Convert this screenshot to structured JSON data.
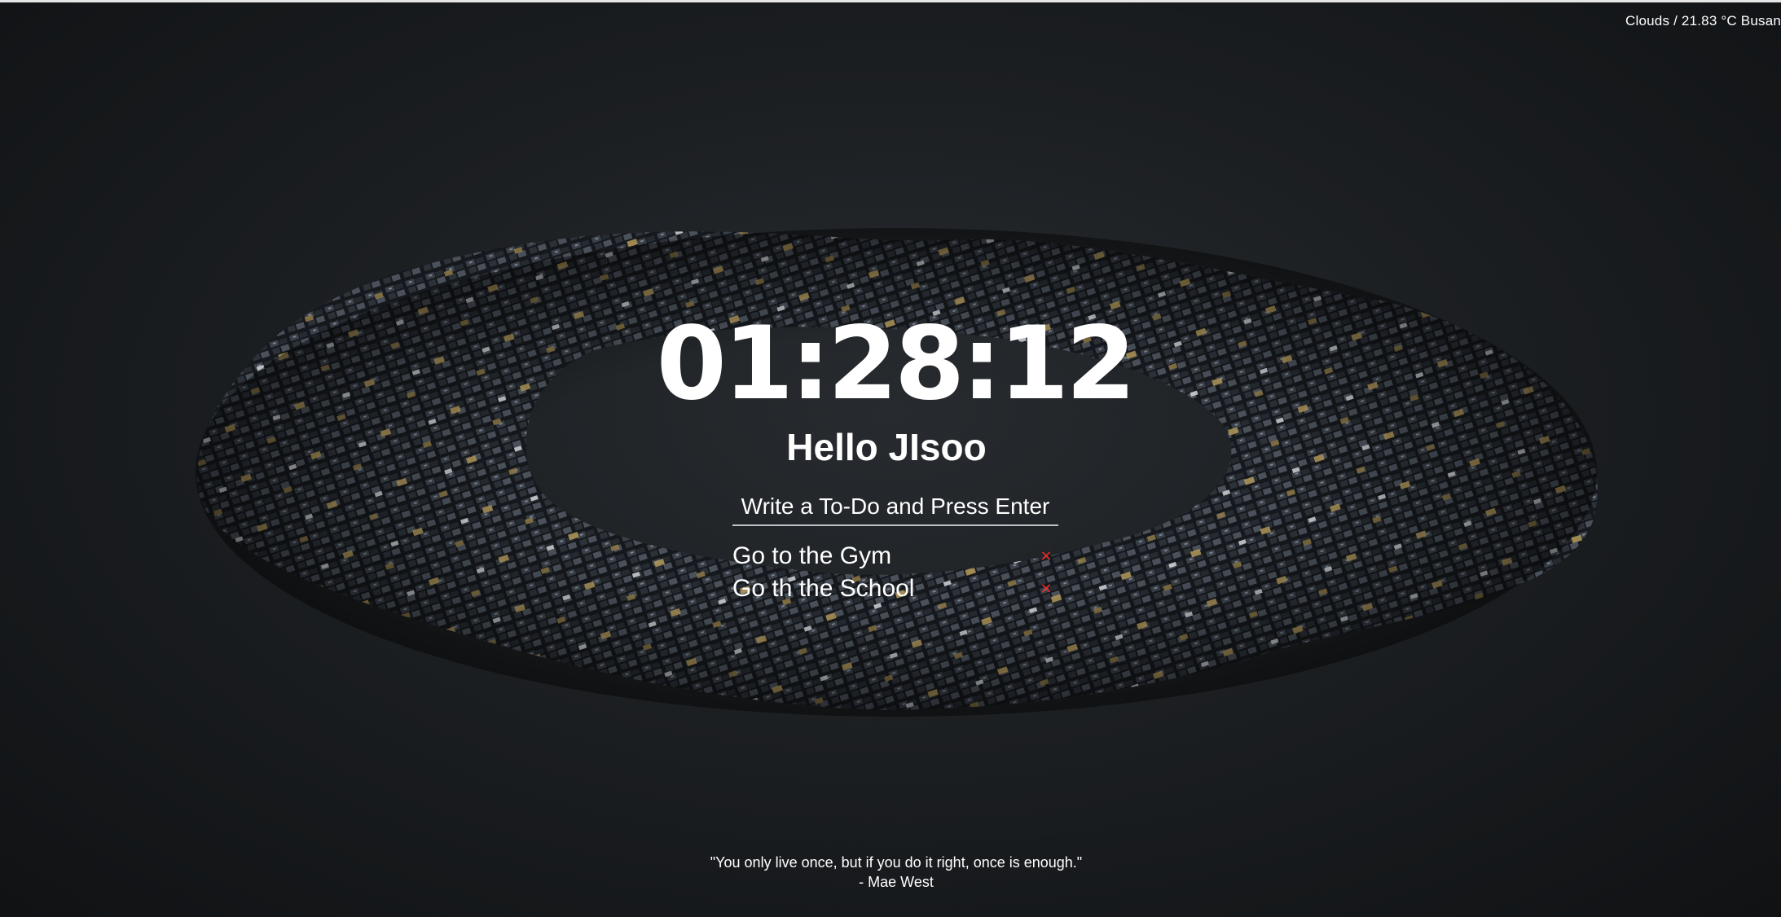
{
  "weather": {
    "text": "Clouds / 21.83 °C Busan"
  },
  "clock": {
    "time": "01:28:12"
  },
  "greeting": {
    "text": "Hello JIsoo"
  },
  "todo": {
    "placeholder": "Write a To-Do and Press Enter",
    "input_value": "",
    "items": [
      {
        "label": "Go to the Gym",
        "delete_label": "×"
      },
      {
        "label": "Go th the School",
        "delete_label": "×"
      }
    ]
  },
  "quote": {
    "text": "\"You only live once, but if you do it right, once is enough.\"",
    "author": "- Mae West"
  },
  "colors": {
    "delete_icon": "#ff2a2a",
    "accent_gold": "#b59a5a"
  }
}
